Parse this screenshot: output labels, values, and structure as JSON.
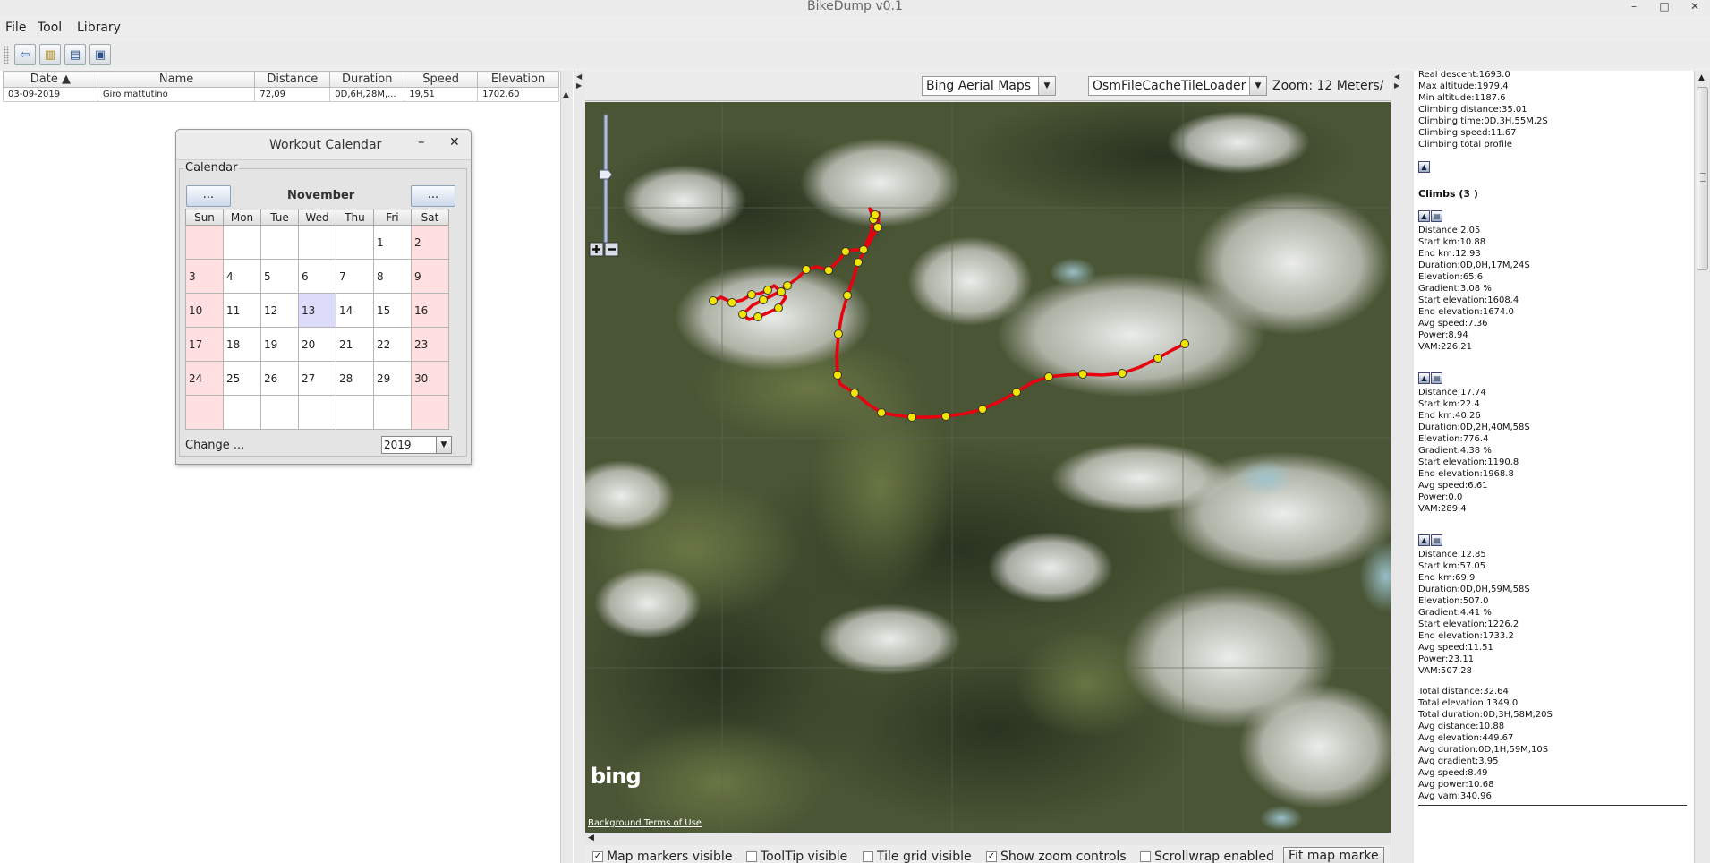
{
  "window": {
    "title": "BikeDump v0.1",
    "minimize": "–",
    "maximize": "□",
    "close": "✕"
  },
  "menu": {
    "file": "File",
    "tool": "Tool",
    "library": "Library"
  },
  "toolbar": {
    "icons": [
      "back-arrow-icon",
      "chart-icon",
      "document-icon",
      "window-icon"
    ],
    "glyphs": [
      "⇦",
      "▥",
      "▤",
      "▣"
    ]
  },
  "workouts": {
    "columns": [
      "Date ▲",
      "Name",
      "Distance",
      "Duration",
      "Speed",
      "Elevation"
    ],
    "rows": [
      {
        "date": "03-09-2019",
        "name": "Giro mattutino",
        "distance": "72,09",
        "duration": "0D,6H,28M,...",
        "speed": "19,51",
        "elevation": "1702,60"
      }
    ]
  },
  "calendar": {
    "title": "Workout Calendar",
    "legend": "Calendar",
    "month": "November",
    "prev_label": "...",
    "next_label": "...",
    "weekdays": [
      "Sun",
      "Mon",
      "Tue",
      "Wed",
      "Thu",
      "Fri",
      "Sat"
    ],
    "weeks": [
      [
        "",
        "",
        "",
        "",
        "",
        "1",
        "2"
      ],
      [
        "3",
        "4",
        "5",
        "6",
        "7",
        "8",
        "9"
      ],
      [
        "10",
        "11",
        "12",
        "13",
        "14",
        "15",
        "16"
      ],
      [
        "17",
        "18",
        "19",
        "20",
        "21",
        "22",
        "23"
      ],
      [
        "24",
        "25",
        "26",
        "27",
        "28",
        "29",
        "30"
      ],
      [
        "",
        "",
        "",
        "",
        "",
        "",
        ""
      ]
    ],
    "today": "13",
    "change_label": "Change ...",
    "year": "2019",
    "weekend_color": "#ffdfdf",
    "today_color": "#dcdcfa"
  },
  "map": {
    "provider": "Bing Aerial Maps",
    "loader": "OsmFileCacheTileLoader",
    "zoom_label": "Zoom:  12 Meters/",
    "logo": "bing",
    "terms": "Background Terms of Use",
    "track_color": "#e8000f",
    "marker_color": "#f2e600",
    "checkboxes": [
      {
        "label": "Map markers visible",
        "checked": true
      },
      {
        "label": "ToolTip visible",
        "checked": false
      },
      {
        "label": "Tile grid visible",
        "checked": false
      },
      {
        "label": "Show zoom controls",
        "checked": true
      },
      {
        "label": "Scrollwrap enabled",
        "checked": false
      }
    ],
    "fit_button": "Fit map marke"
  },
  "stats": {
    "summary": [
      "Real descent:1693.0",
      "Max altitude:1979.4",
      "Min altitude:1187.6",
      "Climbing distance:35.01",
      "Climbing time:0D,3H,55M,2S",
      "Climbing speed:11.67",
      "Climbing total profile"
    ],
    "climbs_header": "Climbs (3 )",
    "climbs": [
      [
        "Distance:2.05",
        "Start km:10.88",
        "End km:12.93",
        "Duration:0D,0H,17M,24S",
        "Elevation:65.6",
        "Gradient:3.08 %",
        "Start elevation:1608.4",
        "End elevation:1674.0",
        "Avg speed:7.36",
        "Power:8.94",
        "VAM:226.21"
      ],
      [
        "Distance:17.74",
        "Start km:22.4",
        "End km:40.26",
        "Duration:0D,2H,40M,58S",
        "Elevation:776.4",
        "Gradient:4.38 %",
        "Start elevation:1190.8",
        "End elevation:1968.8",
        "Avg speed:6.61",
        "Power:0.0",
        "VAM:289.4"
      ],
      [
        "Distance:12.85",
        "Start km:57.05",
        "End km:69.9",
        "Duration:0D,0H,59M,58S",
        "Elevation:507.0",
        "Gradient:4.41 %",
        "Start elevation:1226.2",
        "End elevation:1733.2",
        "Avg speed:11.51",
        "Power:23.11",
        "VAM:507.28"
      ]
    ],
    "totals": [
      "Total distance:32.64",
      "Total elevation:1349.0",
      "Total duration:0D,3H,58M,20S",
      "Avg distance:10.88",
      "Avg elevation:449.67",
      "Avg duration:0D,1H,59M,10S",
      "Avg gradient:3.95",
      "Avg speed:8.49",
      "Avg power:10.68",
      "Avg vam:340.96"
    ]
  }
}
